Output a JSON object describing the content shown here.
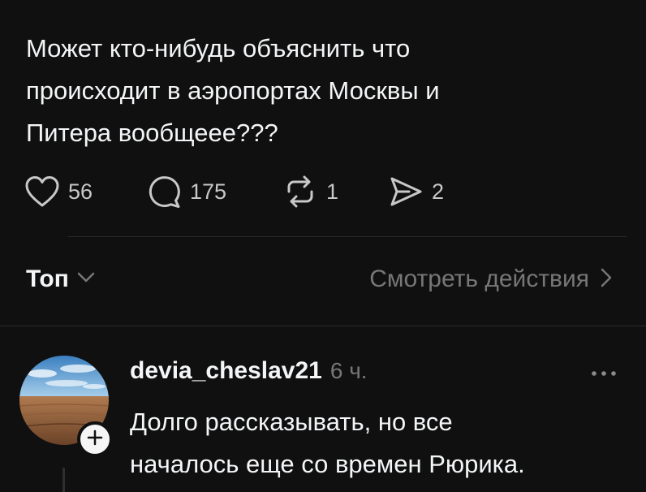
{
  "post": {
    "text_lines": [
      "Может кто-нибудь объяснить что",
      "происходит в аэропортах Москвы и",
      "Питера вообщеее???"
    ],
    "likes": "56",
    "comments": "175",
    "reposts": "1",
    "shares": "2"
  },
  "replies_bar": {
    "sort_label": "Топ",
    "view_activity_label": "Смотреть действия"
  },
  "comment": {
    "username": "devia_cheslav21",
    "timestamp": "6 ч.",
    "text_lines": [
      "Долго рассказывать, но все",
      "началось еще со времен Рюрика."
    ]
  },
  "icons": {
    "like": "heart-icon",
    "comment": "speech-bubble-icon",
    "repost": "repost-arrows-icon",
    "share": "send-icon",
    "sort": "chevron-down-icon",
    "view_activity": "chevron-right-icon",
    "more": "more-horizontal-icon",
    "follow": "plus-icon"
  },
  "colors": {
    "background": "#101010",
    "primary_text": "#f3f5f7",
    "secondary_text": "#777777",
    "divider": "#2a2a2a"
  }
}
